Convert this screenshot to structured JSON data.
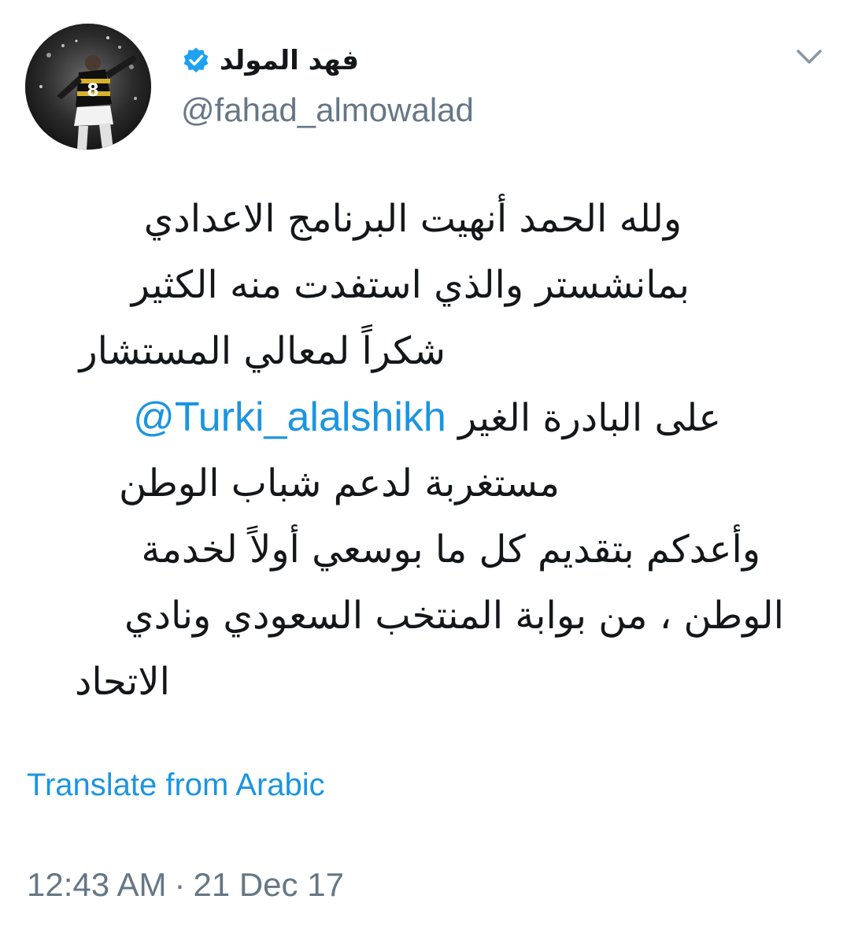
{
  "user": {
    "display_name": "فهد المولد",
    "handle": "@fahad_almowalad",
    "verified": true,
    "avatar_jersey_number": "8"
  },
  "tweet": {
    "lines": [
      "ولله الحمد أنهيت البرنامج الاعدادي",
      "بمانشستر والذي استفدت منه الكثير",
      "شكراً لمعالي المستشار",
      "على البادرة الغير",
      "مستغربة لدعم شباب الوطن",
      "وأعدكم بتقديم كل ما بوسعي أولاً لخدمة",
      "الوطن ، من بوابة المنتخب السعودي ونادي",
      "الاتحاد"
    ],
    "mention": "@Turki_alalshikh"
  },
  "translate_label": "Translate from Arabic",
  "timestamp": {
    "time": "12:43 AM",
    "separator": "·",
    "date": "21 Dec 17"
  },
  "colors": {
    "link": "#1b95e0",
    "secondary_text": "#657786",
    "primary_text": "#14171a",
    "verified_badge": "#1da1f2"
  },
  "icons": {
    "verified": "verified-badge-icon",
    "caret": "chevron-down-icon"
  }
}
